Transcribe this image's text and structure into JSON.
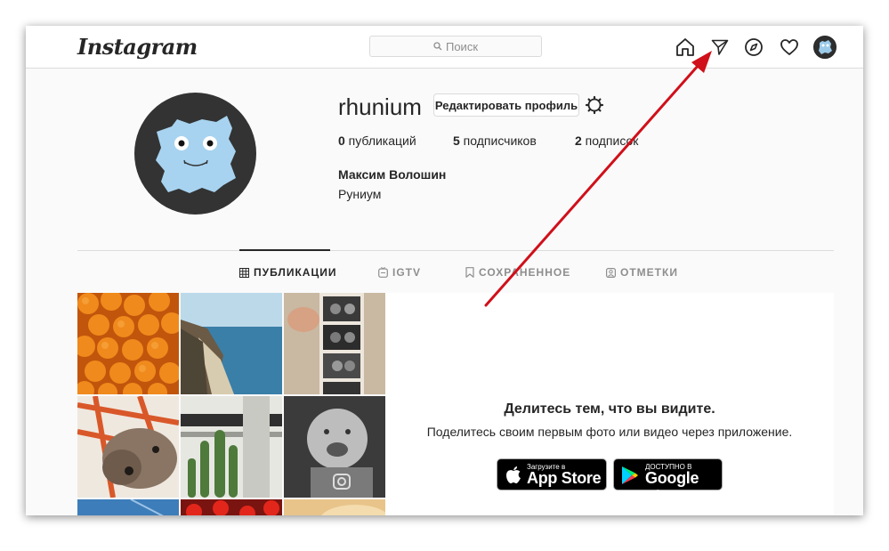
{
  "header": {
    "logo": "Instagram",
    "search_placeholder": "Поиск"
  },
  "nav_icons": [
    "home-icon",
    "direct-icon",
    "explore-icon",
    "activity-heart-icon",
    "profile-avatar"
  ],
  "profile": {
    "username": "rhunium",
    "edit_button": "Редактировать профиль",
    "stats": [
      {
        "count": "0",
        "label": " публикаций"
      },
      {
        "count": "5",
        "label": " подписчиков"
      },
      {
        "count": "2",
        "label": " подписок"
      }
    ],
    "full_name": "Максим Волошин",
    "bio": "Руниум"
  },
  "tabs": [
    {
      "label": "ПУБЛИКАЦИИ",
      "icon": "grid-icon",
      "active": true
    },
    {
      "label": "IGTV",
      "icon": "igtv-icon",
      "active": false
    },
    {
      "label": "СОХРАНЕННОЕ",
      "icon": "bookmark-icon",
      "active": false
    },
    {
      "label": "ОТМЕТКИ",
      "icon": "tag-icon",
      "active": false
    }
  ],
  "promo": {
    "title": "Делитесь тем, что вы видите.",
    "subtitle": "Поделитесь своим первым фото или видео через приложение.",
    "app_store": {
      "small": "Загрузите в",
      "big": "App Store"
    },
    "google_play": {
      "small": "ДОСТУПНО В",
      "big": "Google Play"
    }
  },
  "colors": {
    "annotation_arrow": "#d0101a",
    "border": "#dbdbdb",
    "text": "#262626",
    "muted": "#8e8e8e"
  }
}
